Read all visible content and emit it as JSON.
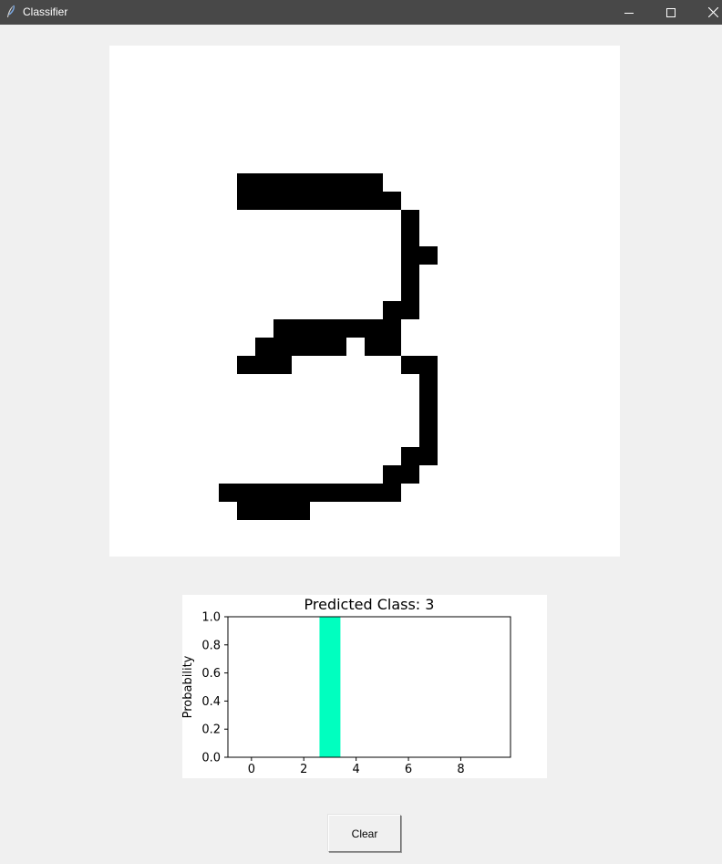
{
  "window": {
    "title": "Classifier",
    "app_icon": "feather-icon",
    "controls": [
      "minimize-icon",
      "maximize-icon",
      "close-icon"
    ]
  },
  "drawing": {
    "grid_size": 28,
    "ink_color": "#000000",
    "background": "#ffffff",
    "strokes": [
      [
        7,
        7
      ],
      [
        8,
        7
      ],
      [
        9,
        7
      ],
      [
        10,
        7
      ],
      [
        11,
        7
      ],
      [
        12,
        7
      ],
      [
        13,
        7
      ],
      [
        14,
        7
      ],
      [
        7,
        8
      ],
      [
        8,
        8
      ],
      [
        9,
        8
      ],
      [
        10,
        8
      ],
      [
        11,
        8
      ],
      [
        12,
        8
      ],
      [
        13,
        8
      ],
      [
        14,
        8
      ],
      [
        15,
        8
      ],
      [
        16,
        9
      ],
      [
        16,
        10
      ],
      [
        16,
        11
      ],
      [
        17,
        11
      ],
      [
        16,
        12
      ],
      [
        16,
        13
      ],
      [
        15,
        14
      ],
      [
        16,
        14
      ],
      [
        9,
        15
      ],
      [
        10,
        15
      ],
      [
        11,
        15
      ],
      [
        12,
        15
      ],
      [
        13,
        15
      ],
      [
        14,
        15
      ],
      [
        15,
        15
      ],
      [
        8,
        16
      ],
      [
        9,
        16
      ],
      [
        10,
        16
      ],
      [
        11,
        16
      ],
      [
        12,
        16
      ],
      [
        14,
        16
      ],
      [
        15,
        16
      ],
      [
        7,
        17
      ],
      [
        8,
        17
      ],
      [
        9,
        17
      ],
      [
        16,
        17
      ],
      [
        17,
        17
      ],
      [
        17,
        18
      ],
      [
        17,
        19
      ],
      [
        17,
        20
      ],
      [
        17,
        21
      ],
      [
        16,
        22
      ],
      [
        17,
        22
      ],
      [
        15,
        23
      ],
      [
        16,
        23
      ],
      [
        6,
        24
      ],
      [
        7,
        24
      ],
      [
        8,
        24
      ],
      [
        9,
        24
      ],
      [
        10,
        24
      ],
      [
        11,
        24
      ],
      [
        12,
        24
      ],
      [
        13,
        24
      ],
      [
        14,
        24
      ],
      [
        15,
        24
      ],
      [
        7,
        25
      ],
      [
        8,
        25
      ],
      [
        9,
        25
      ],
      [
        10,
        25
      ]
    ]
  },
  "chart_data": {
    "type": "bar",
    "title": "Predicted Class: 3",
    "xlabel": "",
    "ylabel": "Probability",
    "categories": [
      0,
      1,
      2,
      3,
      4,
      5,
      6,
      7,
      8,
      9
    ],
    "values": [
      0,
      0,
      0,
      1.0,
      0,
      0,
      0,
      0,
      0,
      0
    ],
    "bar_color": "#00ffbf",
    "xlim": [
      -0.9,
      9.9
    ],
    "ylim": [
      0,
      1.0
    ],
    "xticks": [
      "0",
      "2",
      "4",
      "6",
      "8"
    ],
    "yticks": [
      "0.0",
      "0.2",
      "0.4",
      "0.6",
      "0.8",
      "1.0"
    ],
    "grid": false
  },
  "controls": {
    "clear_label": "Clear"
  }
}
